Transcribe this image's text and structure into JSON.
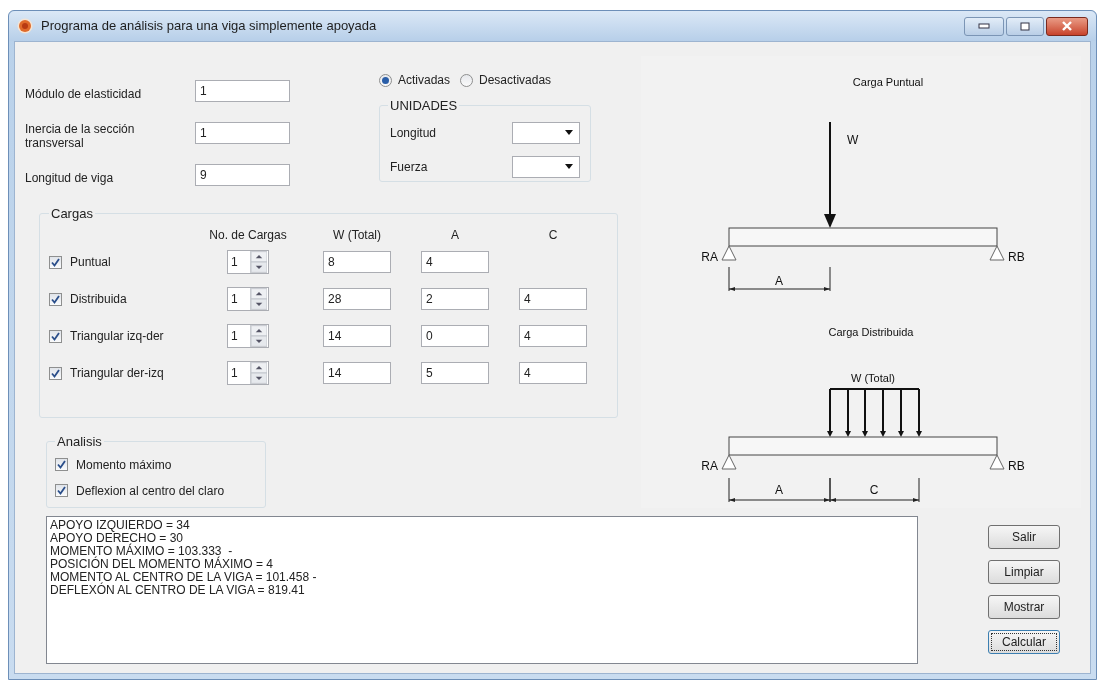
{
  "window": {
    "title": "Programa de análisis para una viga simplemente apoyada"
  },
  "properties": [
    {
      "label": "Módulo de elasticidad",
      "value": "1"
    },
    {
      "label": "Inercia de la sección transversal",
      "value": "1"
    },
    {
      "label": "Longitud de viga",
      "value": "9"
    }
  ],
  "units_mode": [
    {
      "label": "Activadas",
      "selected": true
    },
    {
      "label": "Desactivadas",
      "selected": false
    }
  ],
  "units": {
    "title": "UNIDADES",
    "fields": [
      {
        "label": "Longitud"
      },
      {
        "label": "Fuerza"
      }
    ]
  },
  "loads": {
    "title": "Cargas",
    "columns": [
      "No. de Cargas",
      "W (Total)",
      "A",
      "C"
    ],
    "rows": [
      {
        "label": "Puntual",
        "checked": true,
        "count": "1",
        "w": "8",
        "a": "4"
      },
      {
        "label": "Distribuida",
        "checked": true,
        "count": "1",
        "w": "28",
        "a": "2",
        "c": "4"
      },
      {
        "label": "Triangular izq-der",
        "checked": true,
        "count": "1",
        "w": "14",
        "a": "0",
        "c": "4"
      },
      {
        "label": "Triangular der-izq",
        "checked": true,
        "count": "1",
        "w": "14",
        "a": "5",
        "c": "4"
      }
    ]
  },
  "analysis": {
    "title": "Analisis",
    "options": [
      {
        "label": "Momento máximo",
        "checked": true
      },
      {
        "label": "Deflexion al centro del claro",
        "checked": true
      }
    ]
  },
  "output": {
    "lines": [
      "APOYO IZQUIERDO = 34",
      "APOYO DERECHO = 30",
      "MOMENTO MÁXIMO = 103.333  -",
      "POSICIÓN DEL MOMENTO MÁXIMO = 4",
      "MOMENTO AL CENTRO DE LA VIGA = 101.458 -",
      "DEFLEXÓN AL CENTRO DE LA VIGA = 819.41"
    ]
  },
  "buttons": [
    {
      "label": "Salir",
      "focused": false
    },
    {
      "label": "Limpiar",
      "focused": false
    },
    {
      "label": "Mostrar",
      "focused": false
    },
    {
      "label": "Calcular",
      "focused": true
    }
  ],
  "diagrams": {
    "point": {
      "title": "Carga Puntual",
      "load": "W",
      "left": "RA",
      "right": "RB",
      "a": "A"
    },
    "distributed": {
      "title": "Carga Distribuida",
      "load": "W (Total)",
      "left": "RA",
      "right": "RB",
      "a": "A",
      "c": "C"
    }
  }
}
